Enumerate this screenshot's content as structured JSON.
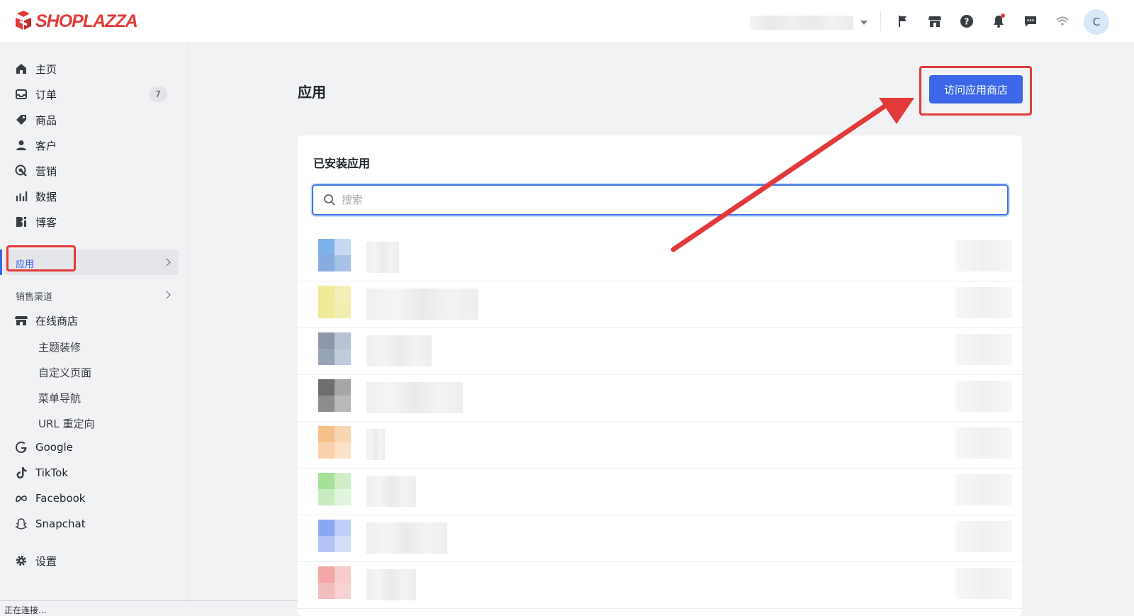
{
  "brand": {
    "name": "SHOPLAZZA",
    "color": "#e23a3a"
  },
  "topbar": {
    "icons": [
      "flag-icon",
      "store-icon",
      "help-icon",
      "bell-icon",
      "chat-icon",
      "wifi-icon"
    ],
    "avatar_initial": "C"
  },
  "sidebar": {
    "items": [
      {
        "label": "主页",
        "icon": "home-icon"
      },
      {
        "label": "订单",
        "icon": "inbox-icon",
        "badge": "7"
      },
      {
        "label": "商品",
        "icon": "tag-icon"
      },
      {
        "label": "客户",
        "icon": "user-icon"
      },
      {
        "label": "营销",
        "icon": "target-icon"
      },
      {
        "label": "数据",
        "icon": "bar-chart-icon"
      },
      {
        "label": "博客",
        "icon": "blog-icon"
      }
    ],
    "active_item": "应用",
    "sales_channels_label": "销售渠道",
    "online_store": "在线商店",
    "online_store_sub": [
      "主题装修",
      "自定义页面",
      "菜单导航",
      "URL 重定向"
    ],
    "channels": [
      "Google",
      "TikTok",
      "Facebook",
      "Snapchat"
    ],
    "settings": "设置"
  },
  "status_bar": "正在连接...",
  "main": {
    "title": "应用",
    "visit_button": "访问应用商店",
    "card_title": "已安装应用",
    "search_placeholder": "搜索"
  },
  "accent_color": "#3c67e8"
}
